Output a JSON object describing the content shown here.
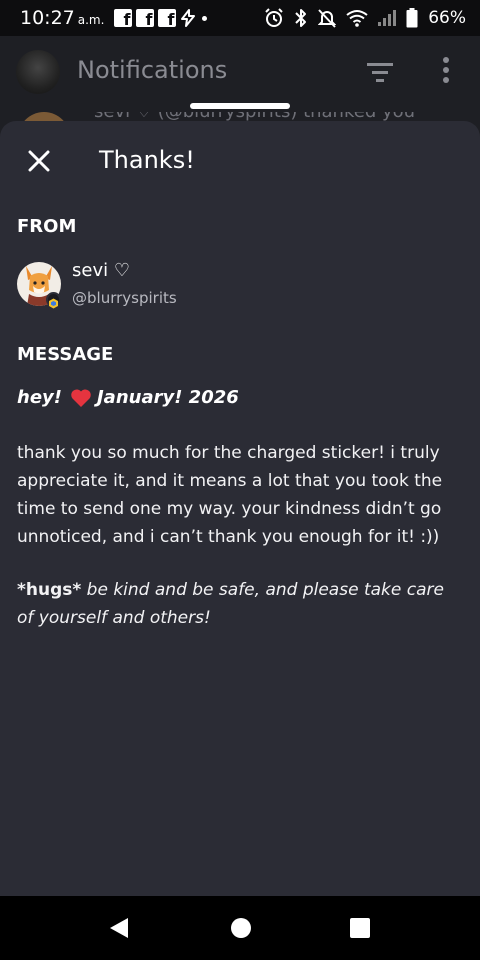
{
  "status_bar": {
    "time": "10:27",
    "ampm": "a.m.",
    "battery": "66%",
    "icons": [
      "facebook-icon",
      "facebook-icon",
      "facebook-icon",
      "bolt-icon",
      "dot-icon",
      "alarm-icon",
      "bluetooth-icon",
      "mute-icon",
      "wifi-icon",
      "signal-icon",
      "battery-icon"
    ]
  },
  "background": {
    "title": "Notifications",
    "row_text": "sevi ♡ (@blurryspirits) thanked you",
    "icons": [
      "avatar",
      "filter-icon",
      "more-vert-icon"
    ]
  },
  "sheet": {
    "title": "Thanks!",
    "from_label": "FROM",
    "sender": {
      "name": "sevi ♡",
      "handle": "@blurryspirits"
    },
    "message_label": "MESSAGE",
    "message": {
      "greeting": "hey!",
      "heart_icon": "red-heart-icon",
      "date": "January! 2026",
      "body": "thank you so much for the charged sticker! i truly appreciate it, and it means a lot that you took the time to send one my way. your kindness didn’t go unnoticed, and i can’t thank you enough for it! :))",
      "closing_bold": "*hugs*",
      "closing_rest": " be kind and be safe, and please take care of yourself and others!"
    }
  },
  "colors": {
    "sheet_bg": "#2b2c35",
    "page_bg": "#1e1f24",
    "heart": "#e5343f"
  }
}
